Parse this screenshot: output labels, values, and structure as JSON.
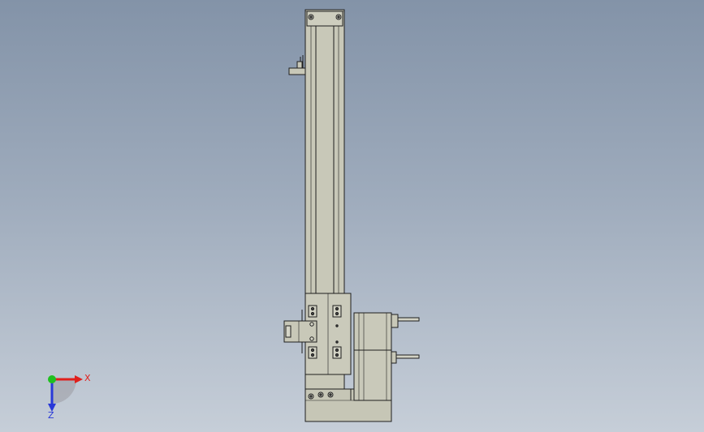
{
  "viewport": {
    "background_top": "#8393a8",
    "background_bottom": "#c6ced8",
    "part_fill": "#c8c8b8",
    "part_edge": "#1e1e1e"
  },
  "triad": {
    "x_label": "X",
    "z_label": "Z",
    "x_color": "#e0201c",
    "y_color": "#1fc01f",
    "z_color": "#2838d8"
  }
}
